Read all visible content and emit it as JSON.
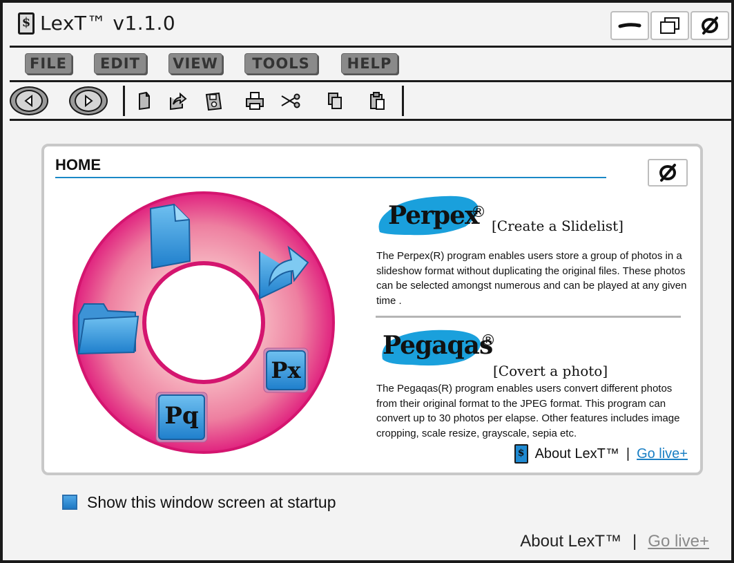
{
  "titlebar": {
    "logo_glyph": "$",
    "title": "LexT™ v1.1.0",
    "minimize_icon": "minimize-icon",
    "maximize_icon": "maximize-icon",
    "close_icon": "close-icon"
  },
  "menu": {
    "items": [
      {
        "label": "FILE"
      },
      {
        "label": "EDIT"
      },
      {
        "label": "VIEW"
      },
      {
        "label": "TOOLS"
      },
      {
        "label": "HELP"
      }
    ]
  },
  "toolbar": {
    "buttons": [
      "back-icon",
      "forward-icon",
      "new-document-icon",
      "share-icon",
      "save-icon",
      "print-icon",
      "cut-icon",
      "copy-icon",
      "paste-icon"
    ]
  },
  "home": {
    "title": "HOME",
    "close_icon": "close-icon",
    "wheel_icons": [
      "document-icon",
      "share-icon",
      "folder-icon",
      "perpex-app-icon",
      "pegaqas-app-icon"
    ],
    "wheel_px_label": "Px",
    "wheel_pq_label": "Pq",
    "products": [
      {
        "name": "Perpex",
        "reg": "®",
        "tagline": "[Create a Slidelist]",
        "description": "The Perpex(R) program enables users store a group of photos in a slideshow format without duplicating the original files. These photos can be selected amongst numerous and can be played at any given time ."
      },
      {
        "name": "Pegaqas",
        "reg": "®",
        "tagline": "[Covert a photo]",
        "description": "The Pegaqas(R) program enables users convert different photos from their original format to the JPEG format. This program can convert up to 30 photos per elapse. Other features includes image cropping, scale resize, grayscale, sepia etc."
      }
    ],
    "about_label": "About LexT™",
    "separator": "|",
    "go_live_label": "Go live+"
  },
  "startup": {
    "checkbox_checked": true,
    "label": "Show this window screen at startup"
  },
  "footer": {
    "about_label": "About LexT™",
    "separator": "|",
    "go_live_label": "Go live+"
  },
  "colors": {
    "accent_blue": "#1a88c6",
    "wheel_pink": "#e0237f",
    "wheel_light_pink": "#f29bb0",
    "link_blue": "#1a7fc4"
  }
}
